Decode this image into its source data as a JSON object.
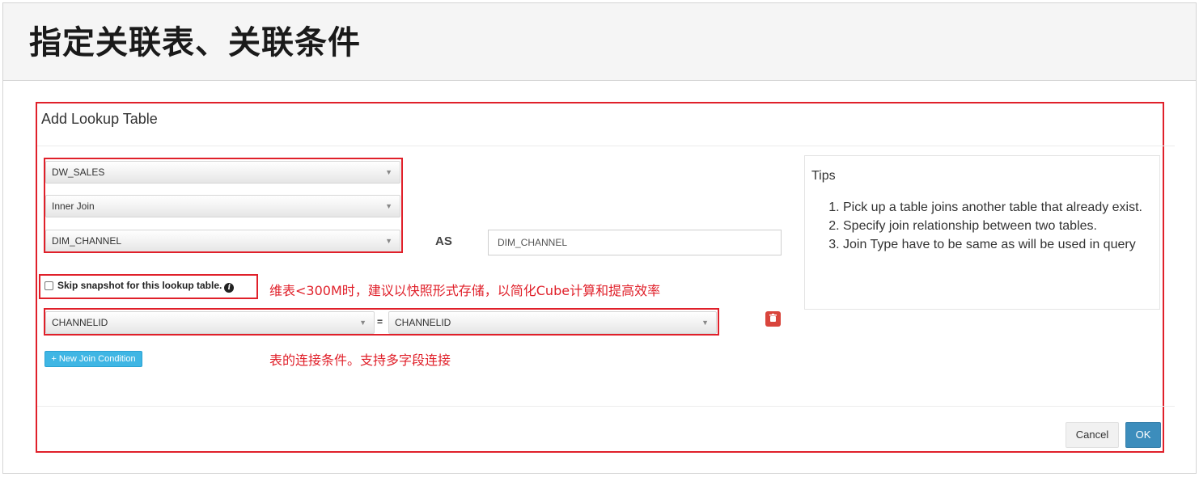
{
  "page": {
    "title": "指定关联表、关联条件"
  },
  "modal": {
    "title": "Add Lookup Table",
    "table_select": {
      "value": "DW_SALES"
    },
    "join_type_select": {
      "value": "Inner Join"
    },
    "lookup_table_select": {
      "value": "DIM_CHANNEL"
    },
    "as_label": "AS",
    "alias_input": {
      "value": "DIM_CHANNEL"
    },
    "skip_snapshot_label": "Skip snapshot for this lookup table.",
    "join_condition": {
      "left_column": "CHANNELID",
      "operator": "=",
      "right_column": "CHANNELID"
    },
    "new_join_button": "+ New Join Condition",
    "cancel_button": "Cancel",
    "ok_button": "OK"
  },
  "tips": {
    "title": "Tips",
    "items": [
      "Pick up a table joins another table that already exist.",
      "Specify join relationship between two tables.",
      "Join Type have to be same as will be used in query"
    ]
  },
  "annotations": {
    "snapshot_note": "维表<300M时，建议以快照形式存储，以简化Cube计算和提高效率",
    "join_note": "表的连接条件。支持多字段连接"
  },
  "colors": {
    "annotation_red": "#e0202a",
    "ok_blue": "#3c8dbc",
    "new_join_blue": "#3fb6e4",
    "delete_red": "#d9453c"
  },
  "icons": {
    "info": "info-circle-icon",
    "delete": "trash-icon",
    "dropdown": "caret-down-icon"
  }
}
